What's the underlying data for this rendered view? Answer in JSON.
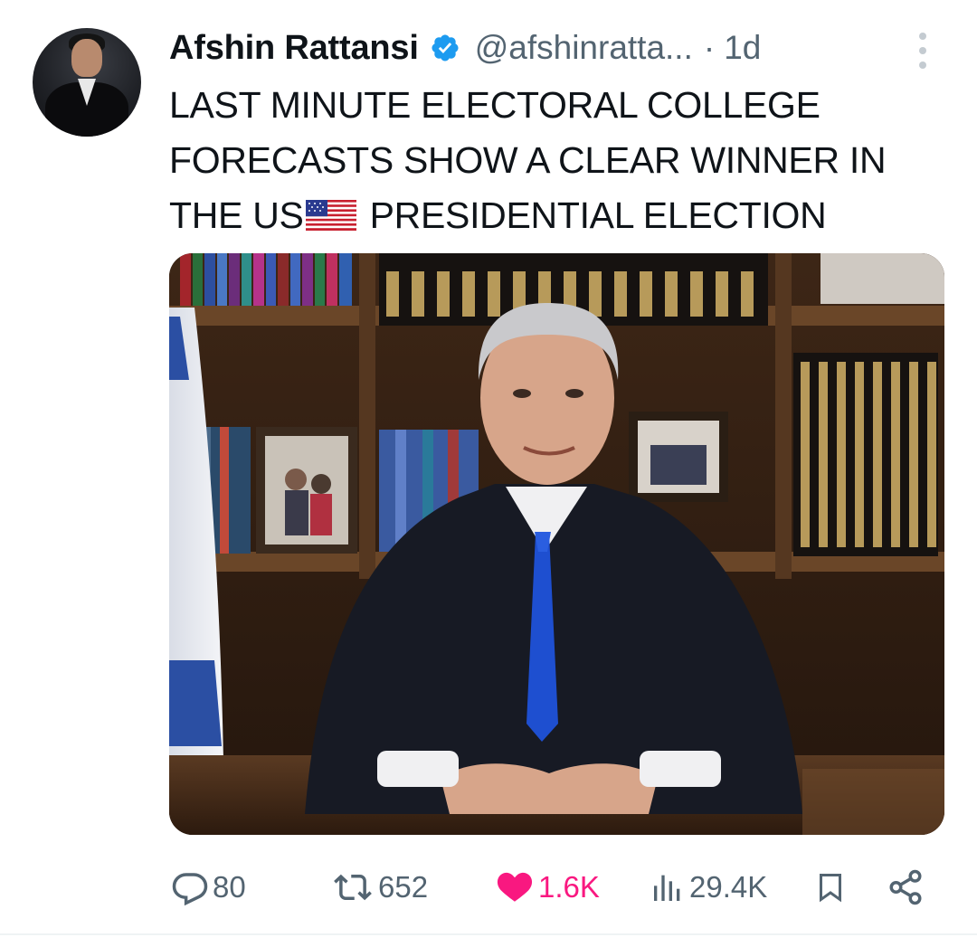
{
  "tweet": {
    "author_name": "Afshin Rattansi",
    "handle": "@afshinratta...",
    "separator": "·",
    "time": "1d",
    "text_lines": [
      "LAST MINUTE ELECTORAL COLLEGE",
      "FORECASTS SHOW A CLEAR WINNER IN"
    ],
    "text_line3_before_flag": "THE US",
    "text_line3_after_flag": " PRESIDENTIAL ELECTION",
    "inline_emoji": "us-flag"
  },
  "actions": {
    "replies": "80",
    "reposts": "652",
    "likes": "1.6K",
    "views": "29.4K"
  },
  "colors": {
    "text": "#0f1419",
    "secondary": "#536471",
    "verified": "#1d9bf0",
    "like": "#f91880"
  },
  "icons": [
    "more-icon",
    "verified-badge-icon",
    "reply-icon",
    "repost-icon",
    "like-icon",
    "views-icon",
    "bookmark-icon",
    "share-icon"
  ]
}
